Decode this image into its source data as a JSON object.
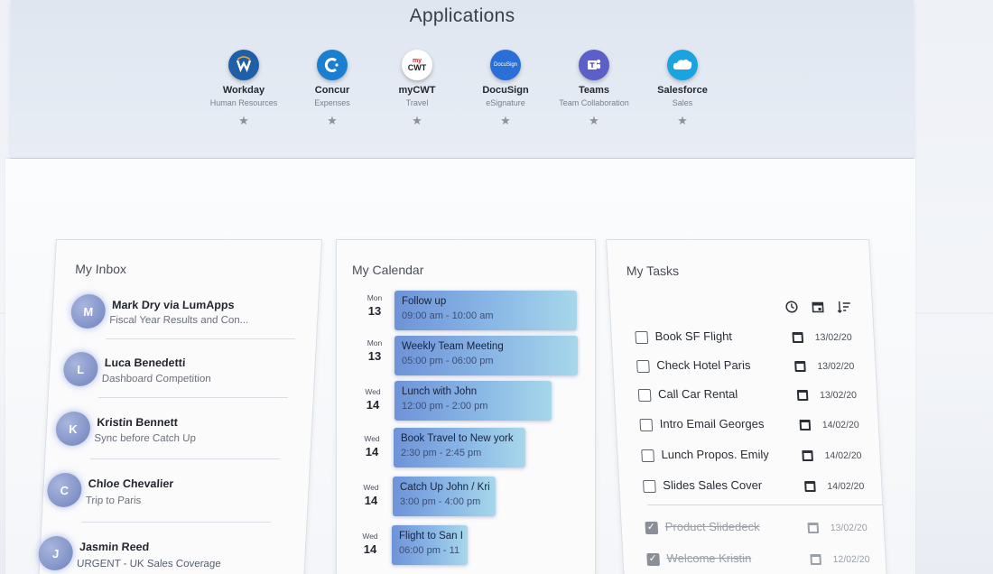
{
  "applications": {
    "title": "Applications",
    "apps": [
      {
        "name": "Workday",
        "sub": "Human Resources",
        "icon": "workday-icon",
        "glyph": "W",
        "color": "#1f5fa8"
      },
      {
        "name": "Concur",
        "sub": "Expenses",
        "icon": "concur-icon",
        "glyph": "C",
        "color": "#1a7fd0"
      },
      {
        "name": "myCWT",
        "sub": "Travel",
        "icon": "mycwt-icon",
        "glyph": "my CWT",
        "color": "#ffffff"
      },
      {
        "name": "DocuSign",
        "sub": "eSignature",
        "icon": "docusign-icon",
        "glyph": "DocuSign",
        "color": "#2a6fd8"
      },
      {
        "name": "Teams",
        "sub": "Team Collaboration",
        "icon": "teams-icon",
        "glyph": "T",
        "color": "#5b5fc7"
      },
      {
        "name": "Salesforce",
        "sub": "Sales",
        "icon": "salesforce-icon",
        "glyph": "sf",
        "color": "#1ba3e0"
      }
    ],
    "star": "★"
  },
  "inbox": {
    "title": "My Inbox",
    "items": [
      {
        "initial": "M",
        "name": "Mark Dry via LumApps",
        "preview": "Fiscal Year Results and Con..."
      },
      {
        "initial": "L",
        "name": "Luca Benedetti",
        "preview": "Dashboard Competition"
      },
      {
        "initial": "K",
        "name": "Kristin Bennett",
        "preview": "Sync before Catch Up"
      },
      {
        "initial": "C",
        "name": "Chloe Chevalier",
        "preview": "Trip to Paris"
      },
      {
        "initial": "J",
        "name": "Jasmin Reed",
        "preview": "URGENT - UK Sales Coverage"
      }
    ]
  },
  "calendar": {
    "title": "My Calendar",
    "events": [
      {
        "dow": "Mon",
        "day": "13",
        "title": "Follow up",
        "time": "09:00 am - 10:00 am"
      },
      {
        "dow": "Mon",
        "day": "13",
        "title": "Weekly Team Meeting",
        "time": "05:00 pm - 06:00 pm"
      },
      {
        "dow": "Wed",
        "day": "14",
        "title": "Lunch with John",
        "time": "12:00 pm - 2:00 pm"
      },
      {
        "dow": "Wed",
        "day": "14",
        "title": "Book Travel to New york",
        "time": "2:30 pm - 2:45 pm"
      },
      {
        "dow": "Wed",
        "day": "14",
        "title": "Catch Up John / Kri",
        "time": "3:00 pm - 4:00 pm"
      },
      {
        "dow": "Wed",
        "day": "14",
        "title": "Flight to San I",
        "time": "06:00 pm - 11"
      }
    ]
  },
  "tasks": {
    "title": "My Tasks",
    "items": [
      {
        "label": "Book SF Flight",
        "date": "13/02/20",
        "done": false
      },
      {
        "label": "Check Hotel Paris",
        "date": "13/02/20",
        "done": false
      },
      {
        "label": "Call Car Rental",
        "date": "13/02/20",
        "done": false
      },
      {
        "label": "Intro Email Georges",
        "date": "14/02/20",
        "done": false
      },
      {
        "label": "Lunch Propos. Emily",
        "date": "14/02/20",
        "done": false
      },
      {
        "label": "Slides Sales Cover",
        "date": "14/02/20",
        "done": false
      },
      {
        "label": "Product Slidedeck",
        "date": "13/02/20",
        "done": true
      },
      {
        "label": "Welcome Kristin",
        "date": "12/02/20",
        "done": true
      }
    ]
  }
}
